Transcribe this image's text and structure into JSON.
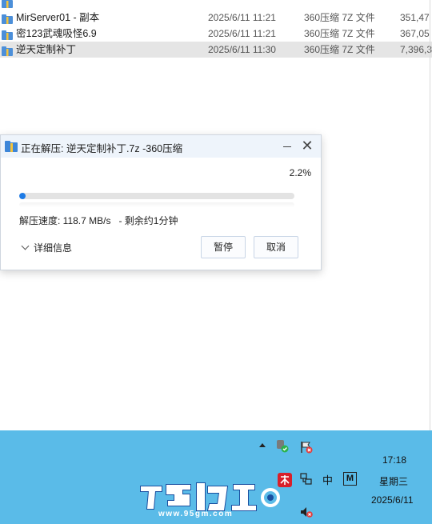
{
  "files": [
    {
      "name": "",
      "date": "",
      "type": "",
      "size": "",
      "selected": false
    },
    {
      "name": "MirServer01 - 副本",
      "date": "2025/6/11 11:21",
      "type": "360压缩 7Z 文件",
      "size": "351,47",
      "selected": false
    },
    {
      "name": "密123武魂吸怪6.9",
      "date": "2025/6/11 11:21",
      "type": "360压缩 7Z 文件",
      "size": "367,05",
      "selected": false
    },
    {
      "name": "逆天定制补丁",
      "date": "2025/6/11 11:30",
      "type": "360压缩 7Z 文件",
      "size": "7,396,3",
      "selected": true
    }
  ],
  "dialog": {
    "title": "正在解压: 逆天定制补丁.7z -360压缩",
    "percent_text": "2.2%",
    "progress": 0.022,
    "speed_text": "解压速度: 118.7 MB/s   - 剩余约1分钟",
    "details_label": "详细信息",
    "pause_label": "暂停",
    "cancel_label": "取消"
  },
  "taskbar": {
    "ime_label": "中",
    "ime_mode": "M",
    "time": "17:18",
    "weekday": "星期三",
    "date": "2025/6/11",
    "watermark_url": "www.95gm.com"
  },
  "colors": {
    "accent": "#1e7be6",
    "taskbar": "#5abbe8",
    "dialog_title_bg": "#eef4fb"
  },
  "icons": [
    "folder-zip-icon",
    "chevron-down-icon",
    "close-icon",
    "minimize-icon",
    "network-icon",
    "shield-icon",
    "volume-muted-icon",
    "tray-app-icon",
    "new-badge-icon"
  ]
}
